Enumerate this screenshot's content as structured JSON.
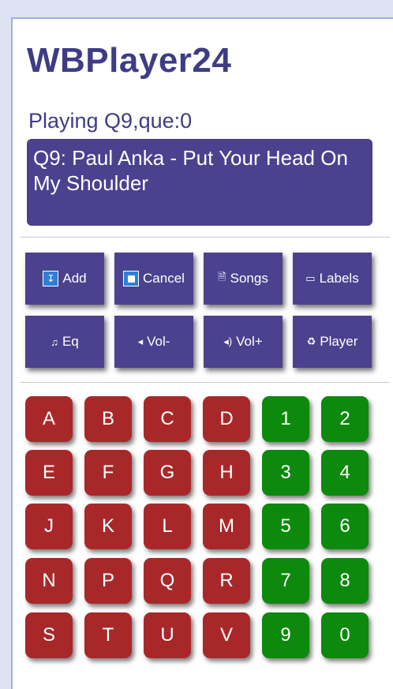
{
  "app": {
    "title": "WBPlayer24"
  },
  "status": {
    "text": "Playing Q9,que:0"
  },
  "now_playing": {
    "text": "Q9: Paul Anka - Put Your Head On My Shoulder"
  },
  "controls": [
    {
      "label": "Add",
      "icon": "down-arrow-box-icon"
    },
    {
      "label": "Cancel",
      "icon": "stop-box-icon"
    },
    {
      "label": "Songs",
      "icon": "document-icon"
    },
    {
      "label": "Labels",
      "icon": "tag-icon"
    },
    {
      "label": "Eq",
      "icon": "music-note-icon"
    },
    {
      "label": "Vol-",
      "icon": "speaker-low-icon"
    },
    {
      "label": "Vol+",
      "icon": "speaker-high-icon"
    },
    {
      "label": "Player",
      "icon": "recycle-icon"
    }
  ],
  "keypad": {
    "rows": [
      [
        "A",
        "B",
        "C",
        "D",
        "1",
        "2"
      ],
      [
        "E",
        "F",
        "G",
        "H",
        "3",
        "4"
      ],
      [
        "J",
        "K",
        "L",
        "M",
        "5",
        "6"
      ],
      [
        "N",
        "P",
        "Q",
        "R",
        "7",
        "8"
      ],
      [
        "S",
        "T",
        "U",
        "V",
        "9",
        "0"
      ]
    ]
  },
  "colors": {
    "accent": "#4b418e",
    "title": "#3f3c85",
    "letter_key": "#a8282a",
    "digit_key": "#0d8a0d",
    "background": "#dde3f3"
  }
}
